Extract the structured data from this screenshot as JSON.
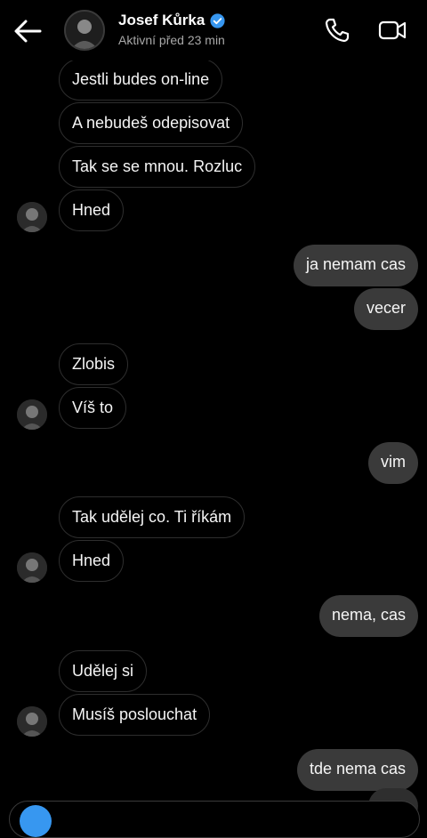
{
  "header": {
    "contact_name": "Josef Kůrka",
    "status": "Aktivní před 23 min"
  },
  "colors": {
    "background": "#000000",
    "incoming_border": "#2e2e2e",
    "outgoing_bubble": "#3a3a3a",
    "verified_badge": "#3797f0"
  },
  "icons": {
    "back": "arrow-left-icon",
    "verified": "verified-badge-icon",
    "call": "phone-icon",
    "video": "video-camera-icon"
  },
  "messages": [
    {
      "from": "them",
      "text": "Jestli budes on-line"
    },
    {
      "from": "them",
      "text": "A nebudeš odepisovat"
    },
    {
      "from": "them",
      "text": "Tak se se mnou. Rozluc"
    },
    {
      "from": "them",
      "text": "Hned"
    },
    {
      "from": "me",
      "text": "ja nemam cas"
    },
    {
      "from": "me",
      "text": "vecer"
    },
    {
      "from": "them",
      "text": "Zlobis"
    },
    {
      "from": "them",
      "text": "Víš to"
    },
    {
      "from": "me",
      "text": "vim"
    },
    {
      "from": "them",
      "text": "Tak udělej co. Ti říkám"
    },
    {
      "from": "them",
      "text": "Hned"
    },
    {
      "from": "me",
      "text": "nema, cas"
    },
    {
      "from": "them",
      "text": "Udělej si"
    },
    {
      "from": "them",
      "text": "Musíš poslouchat"
    },
    {
      "from": "me",
      "text": "tde nema cas"
    }
  ]
}
